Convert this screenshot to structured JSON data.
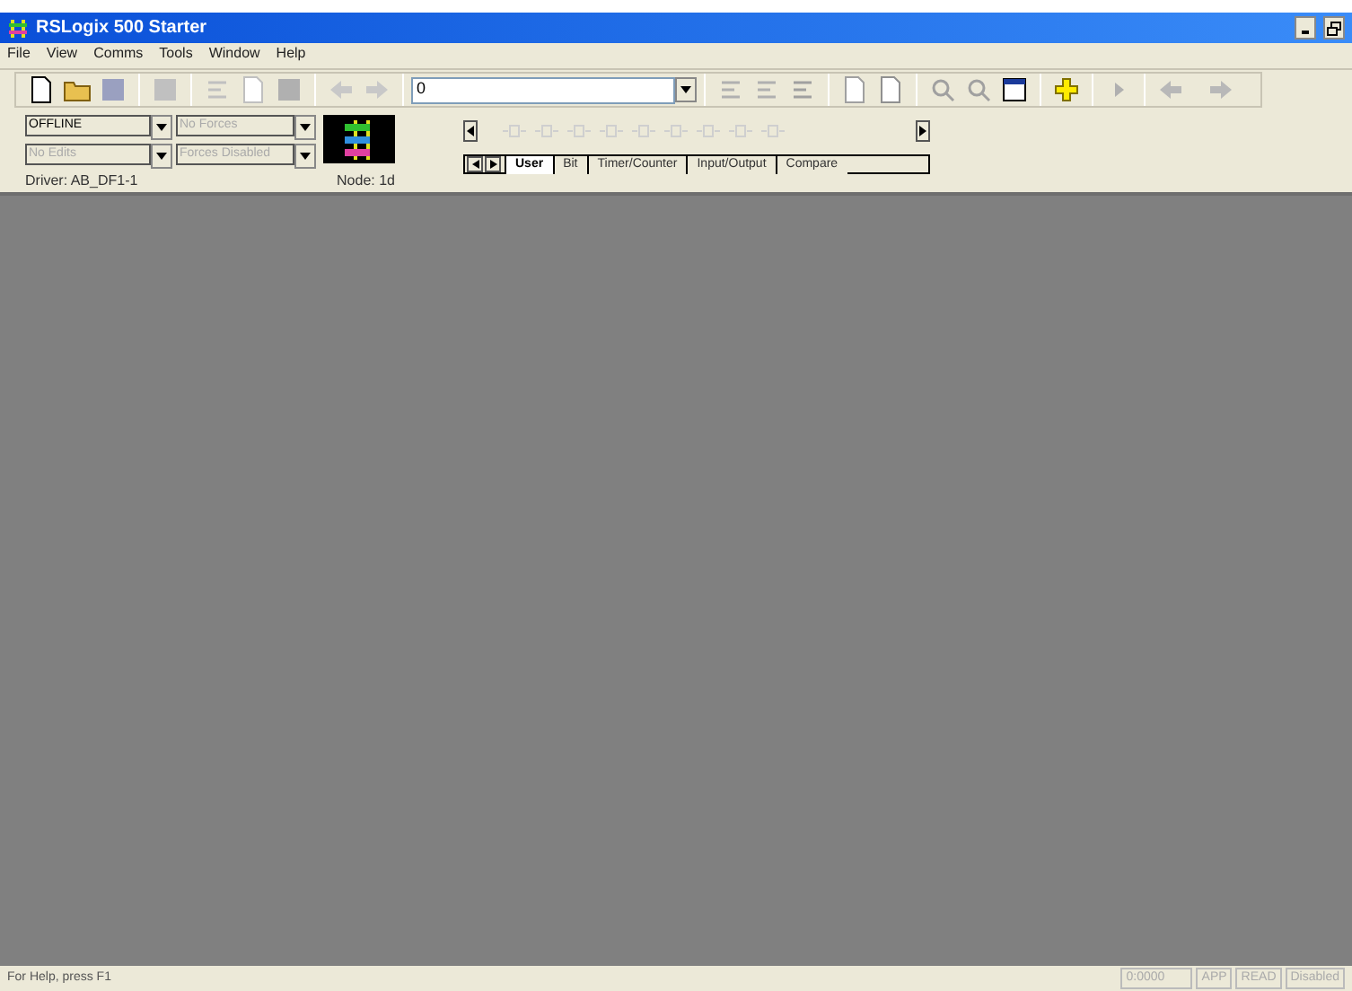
{
  "window": {
    "title": "RSLogix 500 Starter"
  },
  "menu": [
    "File",
    "View",
    "Comms",
    "Tools",
    "Window",
    "Help"
  ],
  "toolbar": {
    "address_field": "0"
  },
  "status_panel": {
    "fields": [
      {
        "label": "OFFLINE",
        "disabled": false
      },
      {
        "label": "No Forces",
        "disabled": true
      },
      {
        "label": "No Edits",
        "disabled": true
      },
      {
        "label": "Forces Disabled",
        "disabled": true
      }
    ],
    "driver": "Driver: AB_DF1-1",
    "node": "Node: 1d"
  },
  "instruction_tabs": [
    {
      "label": "User",
      "selected": true
    },
    {
      "label": "Bit",
      "selected": false
    },
    {
      "label": "Timer/Counter",
      "selected": false
    },
    {
      "label": "Input/Output",
      "selected": false
    },
    {
      "label": "Compare",
      "selected": false
    }
  ],
  "status_bar": {
    "help": "For Help, press F1",
    "panes": [
      "0:0000",
      "APP",
      "READ",
      "Disabled"
    ]
  }
}
